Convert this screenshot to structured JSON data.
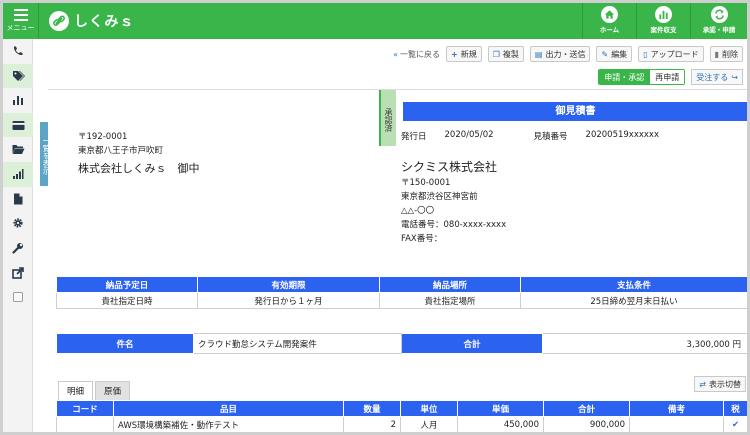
{
  "header": {
    "menu_label": "メニュー",
    "app_name": "しくみｓ",
    "nav": [
      {
        "label": "ホーム",
        "icon": "home-icon"
      },
      {
        "label": "案件収支",
        "icon": "bar-chart-icon"
      },
      {
        "label": "承認・申請",
        "icon": "refresh-icon"
      }
    ]
  },
  "sidebar": {
    "items": [
      {
        "icon": "phone-icon"
      },
      {
        "icon": "tags-icon"
      },
      {
        "icon": "bar-chart-icon"
      },
      {
        "icon": "credit-card-icon"
      },
      {
        "icon": "folder-open-icon"
      },
      {
        "icon": "signal-bars-icon"
      },
      {
        "icon": "document-icon"
      },
      {
        "icon": "gear-icon"
      },
      {
        "icon": "wrench-icon"
      },
      {
        "icon": "external-link-icon"
      },
      {
        "icon": "checkbox-icon"
      }
    ]
  },
  "side_tab": {
    "label": "一覧を表示"
  },
  "toolbar": {
    "back_label": "一覧に戻る",
    "new_label": "新規",
    "copy_label": "複製",
    "output_label": "出力・送信",
    "edit_label": "編集",
    "upload_label": "アップロード",
    "delete_label": "削除"
  },
  "approval": {
    "request_approve_label": "申請・承認",
    "reapply_label": "再申請",
    "accept_label": "受注する"
  },
  "document": {
    "stamp": "承認済",
    "recipient": {
      "postal": "〒192-0001",
      "address": "東京都八王子市戸吹町",
      "company": "株式会社しくみｓ　御中"
    },
    "title": "御見積書",
    "issue_date_label": "発行日",
    "issue_date": "2020/05/02",
    "estimate_no_label": "見積番号",
    "estimate_no": "20200519xxxxxx",
    "issuer": {
      "name": "シクミス株式会社",
      "postal": "〒150-0001",
      "address": "東京都渋谷区神宮前",
      "address2": "△△-〇〇",
      "tel": "電話番号：080-xxxx-xxxx",
      "fax": "FAX番号："
    },
    "terms": {
      "headers": [
        "納品予定日",
        "有効期限",
        "納品場所",
        "支払条件"
      ],
      "values": [
        "貴社指定日時",
        "発行日から１ヶ月",
        "貴社指定場所",
        "25日締め翌月末日払い"
      ]
    },
    "subject_label": "件名",
    "subject": "クラウド勤怠システム開発案件",
    "total_label": "合計",
    "total": "3,300,000 円",
    "tabs": [
      "明細",
      "原価"
    ],
    "switch_label": "表示切替",
    "lines": {
      "headers": [
        "コード",
        "品目",
        "数量",
        "単位",
        "単価",
        "合計",
        "備考",
        "税"
      ],
      "rows": [
        {
          "code": "",
          "item": "AWS環境構築補佐・動作テスト",
          "qty": "2",
          "unit": "人月",
          "price": "450,000",
          "total": "900,000",
          "note": "",
          "tax": "✔"
        }
      ]
    }
  }
}
